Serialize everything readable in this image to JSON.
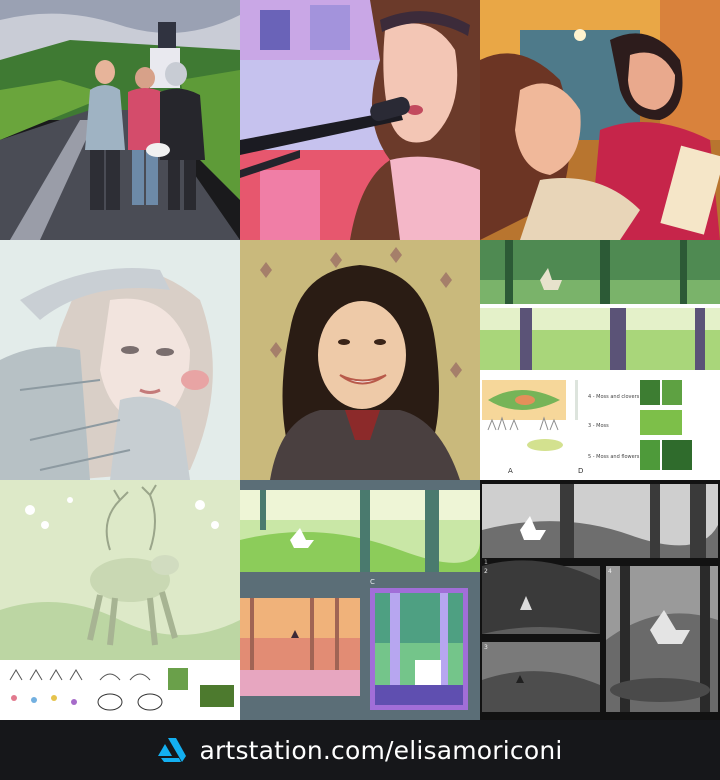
{
  "footer": {
    "logo_icon": "artstation-logo-icon",
    "url_text": "artstation.com/elisamoriconi"
  },
  "colors": {
    "footer_bg": "#16171a",
    "text": "#ffffff",
    "logo_blue": "#13aff0"
  },
  "tiles": [
    {
      "name": "tile-group-portrait-road"
    },
    {
      "name": "tile-singer-microphone"
    },
    {
      "name": "tile-two-women-cafe"
    },
    {
      "name": "tile-sketch-girl-hand"
    },
    {
      "name": "tile-artist-selfie-photo"
    },
    {
      "name": "tile-forest-deer-concept-sheet"
    },
    {
      "name": "tile-flower-deer-character-sheet"
    },
    {
      "name": "tile-forest-color-studies"
    },
    {
      "name": "tile-grayscale-storyboard"
    }
  ],
  "annotations": {
    "sheet_labels": [
      "4 - Moss and clovers",
      "3 - Moss",
      "5 - Moss and flowers"
    ],
    "panel_letters": [
      "A",
      "D",
      "C"
    ],
    "storyboard_numbers": [
      "1",
      "2",
      "4",
      "3"
    ]
  }
}
